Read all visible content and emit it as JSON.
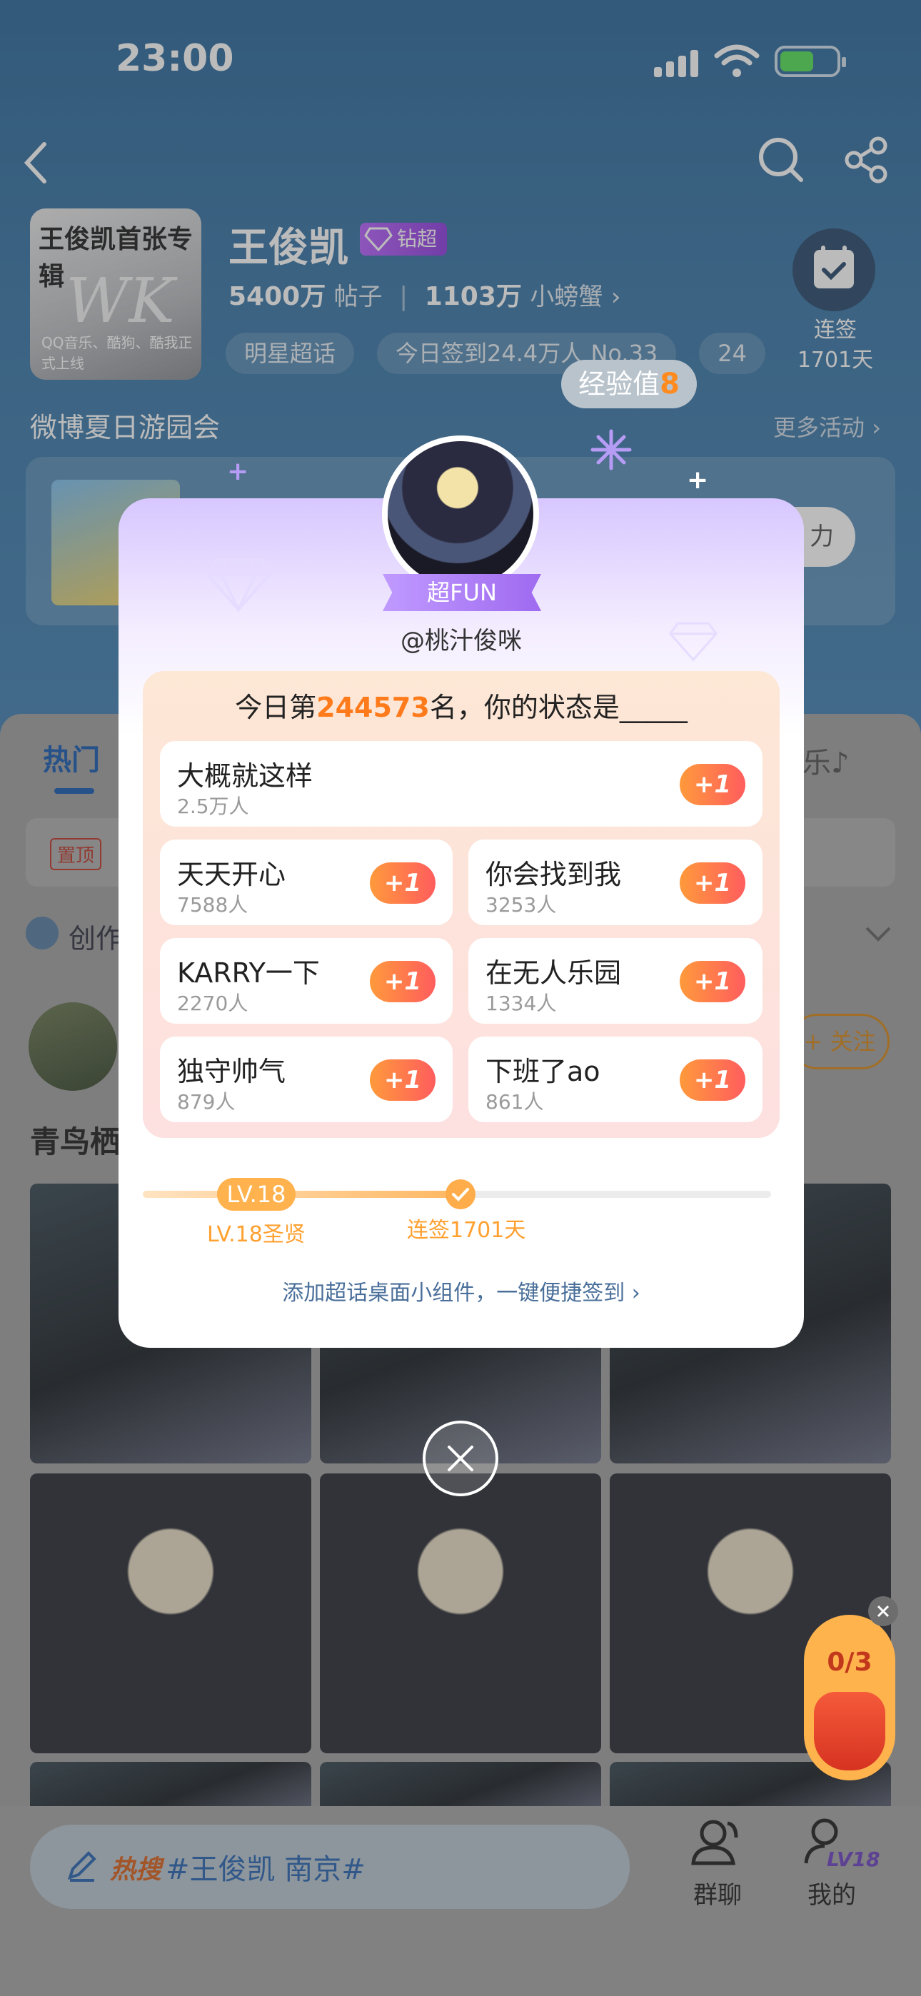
{
  "status_bar": {
    "time": "23:00"
  },
  "header": {
    "star_name": "王俊凯",
    "badge": "钻超",
    "posts_count": "5400万",
    "posts_label": "帖子",
    "fans_count": "1103万",
    "fans_label": "小螃蟹",
    "chips": [
      "明星超话",
      "今日签到24.4万人 No.33",
      "24"
    ],
    "checkin_label": "连签",
    "checkin_days": "1701天",
    "album_title": "王俊凯首张专辑",
    "album_caption": "QQ音乐、酷狗、酷我正式上线"
  },
  "promo": {
    "title": "微博夏日游园会",
    "more": "更多活动",
    "button": "力"
  },
  "content": {
    "tab_hot": "热门",
    "tab_music": "乐♪",
    "pin_badge": "置顶",
    "create_label": "创作",
    "follow_label": "+ 关注",
    "post_title": "青鸟栖"
  },
  "popup": {
    "exp_label": "经验值",
    "exp_value": "8",
    "fun_badge": "超FUN",
    "username": "@桃汁俊咪",
    "status_prefix": "今日第",
    "status_rank": "244573",
    "status_suffix": "名，你的状态是_____",
    "plus_label": "+1",
    "options": [
      {
        "name": "大概就这样",
        "count": "2.5万人"
      },
      {
        "name": "天天开心",
        "count": "7588人"
      },
      {
        "name": "你会找到我",
        "count": "3253人"
      },
      {
        "name": "KARRY一下",
        "count": "2270人"
      },
      {
        "name": "在无人乐园",
        "count": "1334人"
      },
      {
        "name": "独守帅气",
        "count": "879人"
      },
      {
        "name": "下班了ao",
        "count": "861人"
      }
    ],
    "level_pill": "LV.18",
    "level_label": "LV.18圣贤",
    "signin_label": "连签1701天",
    "widget_link": "添加超话桌面小组件，一键便捷签到"
  },
  "lucky_bag": {
    "count": "0/3"
  },
  "bottom_bar": {
    "hot_tag": "热搜",
    "hot_text": "#王俊凯 南京#",
    "group_chat": "群聊",
    "mine": "我的",
    "mine_level": "LV18"
  }
}
